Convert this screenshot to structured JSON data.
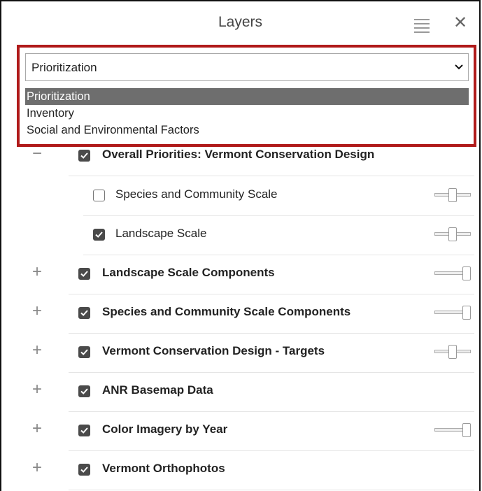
{
  "panel": {
    "title": "Layers",
    "menu_icon": "menu-lines-icon",
    "close_icon": "close-icon",
    "close_glyph": "✕"
  },
  "dropdown": {
    "selected": "Prioritization",
    "options": [
      "Prioritization",
      "Inventory",
      "Social and Environmental Factors"
    ],
    "highlight_color": "#b01a1a"
  },
  "layers": [
    {
      "label": "Overall Priorities: Vermont Conservation Design",
      "expander": "−",
      "checked": true,
      "bold": true,
      "slider": null
    },
    {
      "label": "Species and Community Scale",
      "expander": "",
      "checked": false,
      "bold": false,
      "slider": 0.5
    },
    {
      "label": "Landscape Scale",
      "expander": "",
      "checked": true,
      "bold": false,
      "slider": 0.5
    },
    {
      "label": "Landscape Scale Components",
      "expander": "+",
      "checked": true,
      "bold": true,
      "slider": 1.0
    },
    {
      "label": "Species and Community Scale Components",
      "expander": "+",
      "checked": true,
      "bold": true,
      "slider": 1.0
    },
    {
      "label": "Vermont Conservation Design - Targets",
      "expander": "+",
      "checked": true,
      "bold": true,
      "slider": 0.5
    },
    {
      "label": "ANR Basemap Data",
      "expander": "+",
      "checked": true,
      "bold": true,
      "slider": null
    },
    {
      "label": "Color Imagery by Year",
      "expander": "+",
      "checked": true,
      "bold": true,
      "slider": 1.0
    },
    {
      "label": "Vermont Orthophotos",
      "expander": "+",
      "checked": true,
      "bold": true,
      "slider": null
    }
  ]
}
